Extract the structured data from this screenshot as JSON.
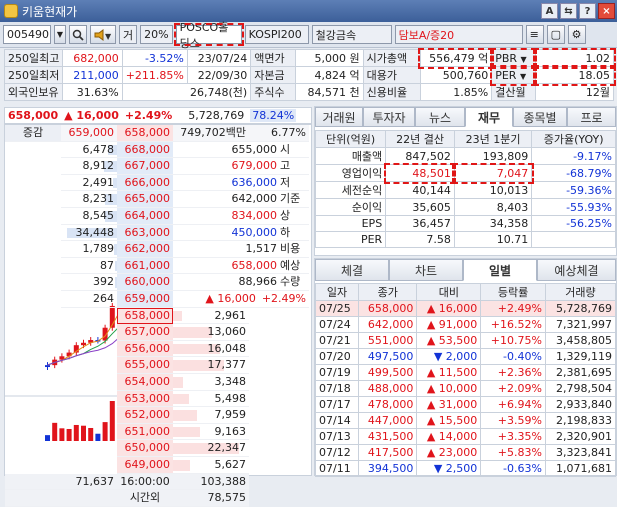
{
  "window": {
    "title": "키움현재가",
    "btn_a": "A",
    "btn_pin": "⇆",
    "btn_help": "?",
    "btn_close": "×"
  },
  "toolbar": {
    "code": "005490",
    "search_icon": "search-icon",
    "sound_icon": "speaker-icon",
    "ge": "거",
    "pct": "20%",
    "name": "POSCO홀딩스",
    "index": "KOSPI200",
    "sector": "철강금속",
    "loan": "담보A/증20"
  },
  "info": [
    [
      "250일최고",
      "682,000",
      "-3.52%",
      "23/07/24",
      "액면가",
      "5,000 원",
      "시가총액",
      "556,479 억",
      "PBR",
      "1.02"
    ],
    [
      "250일최저",
      "211,000",
      "+211.85%",
      "22/09/30",
      "자본금",
      "4,824 억",
      "대용가",
      "500,760",
      "PER",
      "18.05"
    ],
    [
      "외국인보유",
      "31.63%",
      "26,748(천)",
      "",
      "주식수",
      "84,571 천",
      "신용비율",
      "1.85%",
      "결산월",
      "12월"
    ]
  ],
  "quote": {
    "price": "658,000",
    "change": "▲ 16,000",
    "rate": "+2.49%",
    "volume": "5,728,769",
    "vol_rate": "78.24%"
  },
  "ob_header": {
    "c1": "증감",
    "c2": "659,000",
    "c3": "658,000",
    "c4": "749,702백만",
    "c5": "6.77%"
  },
  "asks": [
    [
      "6,478",
      "668,000"
    ],
    [
      "8,912",
      "667,000"
    ],
    [
      "2,491",
      "666,000"
    ],
    [
      "8,231",
      "665,000"
    ],
    [
      "8,545",
      "664,000"
    ],
    [
      "34,448",
      "663,000"
    ],
    [
      "1,789",
      "662,000"
    ],
    [
      "87",
      "661,000"
    ],
    [
      "392",
      "660,000"
    ],
    [
      "264",
      "659,000"
    ]
  ],
  "bids": [
    [
      "658,000",
      "2,961"
    ],
    [
      "657,000",
      "13,060"
    ],
    [
      "656,000",
      "16,048"
    ],
    [
      "655,000",
      "17,377"
    ],
    [
      "654,000",
      "3,348"
    ],
    [
      "653,000",
      "5,498"
    ],
    [
      "652,000",
      "7,959"
    ],
    [
      "651,000",
      "9,163"
    ],
    [
      "650,000",
      "22,347"
    ],
    [
      "649,000",
      "5,627"
    ]
  ],
  "ask_info": [
    [
      "655,000",
      "시"
    ],
    [
      "679,000",
      "고"
    ],
    [
      "636,000",
      "저"
    ],
    [
      "642,000",
      "기준"
    ],
    [
      "834,000",
      "상"
    ],
    [
      "450,000",
      "하"
    ],
    [
      "1,517",
      "비용"
    ],
    [
      "658,000",
      "예상"
    ],
    [
      "88,966",
      "수량"
    ]
  ],
  "ask_info_last": {
    "change": "▲ 16,000",
    "rate": "+2.49%"
  },
  "ob_footer": {
    "total_ask": "71,637",
    "time": "16:00:00",
    "total_bid": "103,388",
    "after_label": "시간외",
    "after_val": "78,575"
  },
  "fin_tabs": [
    "거래원",
    "투자자",
    "뉴스",
    "재무",
    "종목별",
    "프로"
  ],
  "fin_head": [
    "단위(억원)",
    "22년 결산",
    "23년 1분기",
    "증가율(YOY)"
  ],
  "fin_rows": [
    [
      "매출액",
      "847,502",
      "193,809",
      "-9.17%"
    ],
    [
      "영업이익",
      "48,501",
      "7,047",
      "-68.79%"
    ],
    [
      "세전순익",
      "40,144",
      "10,013",
      "-59.36%"
    ],
    [
      "순이익",
      "35,605",
      "8,403",
      "-55.93%"
    ],
    [
      "EPS",
      "36,457",
      "34,358",
      "-56.25%"
    ],
    [
      "PER",
      "7.58",
      "10.71",
      ""
    ]
  ],
  "daily_tabs": [
    "체결",
    "차트",
    "일별",
    "예상체결"
  ],
  "daily_head": [
    "일자",
    "종가",
    "대비",
    "등락률",
    "거래량"
  ],
  "daily_rows": [
    [
      "07/25",
      "658,000",
      "▲ 16,000",
      "+2.49%",
      "5,728,769",
      "up"
    ],
    [
      "07/24",
      "642,000",
      "▲ 91,000",
      "+16.52%",
      "7,321,997",
      "up"
    ],
    [
      "07/21",
      "551,000",
      "▲ 53,500",
      "+10.75%",
      "3,458,805",
      "up"
    ],
    [
      "07/20",
      "497,500",
      "▼ 2,000",
      "-0.40%",
      "1,329,119",
      "down"
    ],
    [
      "07/19",
      "499,500",
      "▲ 11,500",
      "+2.36%",
      "2,381,695",
      "up"
    ],
    [
      "07/18",
      "488,000",
      "▲ 10,000",
      "+2.09%",
      "2,798,504",
      "up"
    ],
    [
      "07/17",
      "478,000",
      "▲ 31,000",
      "+6.94%",
      "2,933,840",
      "up"
    ],
    [
      "07/14",
      "447,000",
      "▲ 15,500",
      "+3.59%",
      "2,198,833",
      "up"
    ],
    [
      "07/13",
      "431,500",
      "▲ 14,000",
      "+3.35%",
      "2,320,901",
      "up"
    ],
    [
      "07/12",
      "417,500",
      "▲ 23,000",
      "+5.83%",
      "3,323,841",
      "up"
    ],
    [
      "07/11",
      "394,500",
      "▼ 2,500",
      "-0.63%",
      "1,071,681",
      "down"
    ]
  ],
  "colors": {
    "up": "#e0141b",
    "down": "#1233d6",
    "ask_bg": "#e2ebf8",
    "bid_bg": "#fbe3e3"
  }
}
